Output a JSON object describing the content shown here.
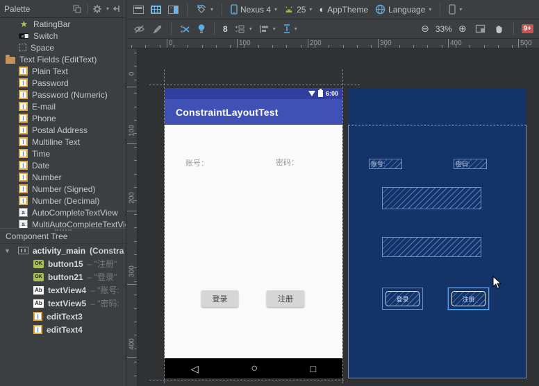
{
  "window": {
    "canvas_bg": "#2f3133",
    "panel_bg": "#3c3f41"
  },
  "icons": {
    "rating_star": "★",
    "dropdown": "▾",
    "expander": "▼",
    "zoom_out": "⊖",
    "zoom_in": "⊕",
    "theme_half_circle": "◐",
    "nav_back": "◁",
    "nav_home": "○",
    "nav_recents": "□",
    "edittext_beam": "I",
    "autocomplete_a": "a",
    "button_ok": "OK",
    "textview_ab": "Ab"
  },
  "palette": {
    "title": "Palette",
    "items": [
      {
        "label": "RatingBar",
        "icon": "star",
        "group": false
      },
      {
        "label": "Switch",
        "icon": "switch",
        "group": false
      },
      {
        "label": "Space",
        "icon": "space",
        "group": false
      },
      {
        "label": "Text Fields (EditText)",
        "icon": "folder",
        "group": true
      },
      {
        "label": "Plain Text",
        "icon": "edittext",
        "group": false
      },
      {
        "label": "Password",
        "icon": "edittext",
        "group": false
      },
      {
        "label": "Password (Numeric)",
        "icon": "edittext",
        "group": false
      },
      {
        "label": "E-mail",
        "icon": "edittext",
        "group": false
      },
      {
        "label": "Phone",
        "icon": "edittext",
        "group": false
      },
      {
        "label": "Postal Address",
        "icon": "edittext",
        "group": false
      },
      {
        "label": "Multiline Text",
        "icon": "edittext",
        "group": false
      },
      {
        "label": "Time",
        "icon": "edittext",
        "group": false
      },
      {
        "label": "Date",
        "icon": "edittext",
        "group": false
      },
      {
        "label": "Number",
        "icon": "edittext",
        "group": false
      },
      {
        "label": "Number (Signed)",
        "icon": "edittext",
        "group": false
      },
      {
        "label": "Number (Decimal)",
        "icon": "edittext",
        "group": false
      },
      {
        "label": "AutoCompleteTextView",
        "icon": "autocomplete",
        "group": false
      },
      {
        "label": "MultiAutoCompleteTextView",
        "icon": "autocomplete",
        "group": false
      }
    ]
  },
  "component_tree": {
    "title": "Component Tree",
    "items": [
      {
        "name": "activity_main",
        "suffix": "(Constra",
        "icon": "constraintlayout",
        "root": true
      },
      {
        "name": "button15",
        "suffix": "– \"注册\"",
        "icon": "button",
        "root": false
      },
      {
        "name": "button21",
        "suffix": "– \"登录\"",
        "icon": "button",
        "root": false
      },
      {
        "name": "textView4",
        "suffix": "– \"账号:",
        "icon": "textview",
        "root": false
      },
      {
        "name": "textView5",
        "suffix": "– \"密码:",
        "icon": "textview",
        "root": false
      },
      {
        "name": "editText3",
        "suffix": "",
        "icon": "edittext",
        "root": false
      },
      {
        "name": "editText4",
        "suffix": "",
        "icon": "edittext",
        "root": false
      }
    ]
  },
  "toolbar": {
    "device": "Nexus 4",
    "api_level": "25",
    "theme": "AppTheme",
    "language": "Language",
    "default_margin": "8",
    "zoom_level": "33%",
    "error_count": "9+"
  },
  "rulers": {
    "horizontal_labels": [
      "0",
      "100",
      "200",
      "300",
      "400",
      "500"
    ],
    "vertical_labels": [
      "0",
      "100",
      "200",
      "300",
      "400"
    ]
  },
  "design_view": {
    "status_time": "6:00",
    "app_bar_title": "ConstraintLayoutTest",
    "account_label": "账号：",
    "password_label": "密码：",
    "login_button": "登录",
    "register_button": "注册",
    "app_bar_color": "#3F51B5",
    "status_bar_color": "#303F9F"
  },
  "blueprint_view": {
    "account_label": "账号:",
    "password_label": "密码:",
    "login_button": "登录",
    "register_button": "注册",
    "background": "#143369",
    "selection_color": "#4FA8F5"
  }
}
